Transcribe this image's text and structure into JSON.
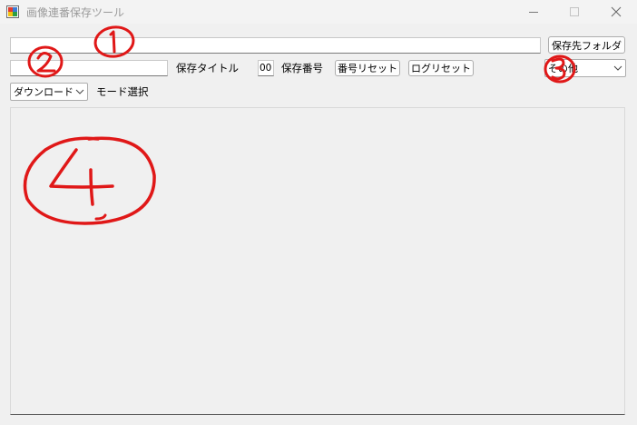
{
  "window": {
    "title": "画像連番保存ツール",
    "icon": "app-window-icon"
  },
  "toolbar": {
    "folder_path_value": "",
    "save_folder_button": "保存先フォルダ",
    "save_title_value": "",
    "save_title_label": "保存タイトル",
    "save_number_value": "00",
    "save_number_label": "保存番号",
    "number_reset_button": "番号リセット",
    "log_reset_button": "ログリセット",
    "right_combo_value": "その他",
    "mode_combo_value": "ダウンロード",
    "mode_label": "モード選択"
  },
  "log": {
    "content": ""
  },
  "annotations": {
    "marker_1": "1",
    "marker_2": "2",
    "marker_3": "3",
    "marker_4": "4",
    "ink_color": "#e01818"
  }
}
